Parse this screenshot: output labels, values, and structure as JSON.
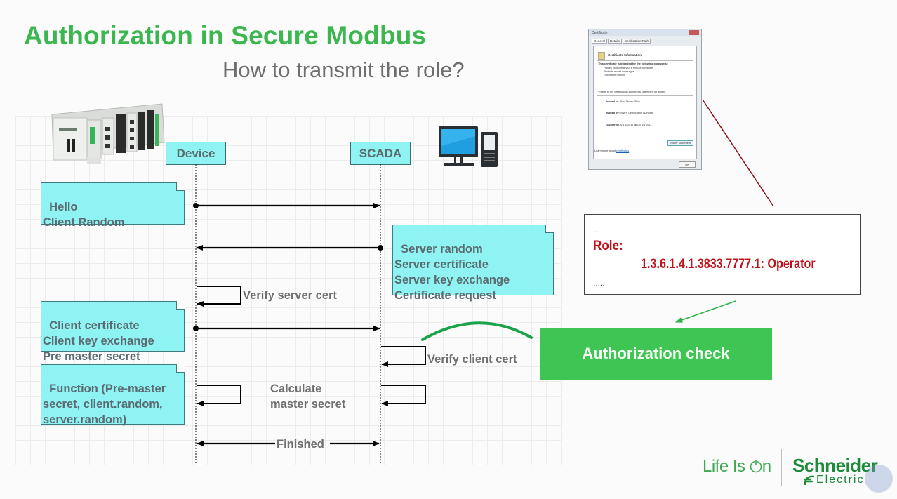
{
  "slide": {
    "title": "Authorization in Secure Modbus",
    "subtitle": "How to transmit the role?"
  },
  "sequence": {
    "participants": [
      {
        "id": "device",
        "label": "Device",
        "icon": "plc-controller-icon"
      },
      {
        "id": "scada",
        "label": "SCADA",
        "icon": "desktop-computer-icon"
      }
    ],
    "notes": [
      {
        "id": "hello",
        "text": "Hello\nClient Random"
      },
      {
        "id": "server-hello",
        "text": "Server random\nServer certificate\nServer key exchange\nCertificate request"
      },
      {
        "id": "client-cert",
        "text": "Client certificate\nClient key exchange\nPre master secret"
      },
      {
        "id": "function",
        "text": "Function (Pre-master\nsecret, client.random,\nserver.random)"
      }
    ],
    "messages": [
      {
        "from": "device",
        "to": "scada",
        "label": ""
      },
      {
        "from": "scada",
        "to": "device",
        "label": ""
      },
      {
        "from": "device",
        "to": "device",
        "label": "Verify server cert"
      },
      {
        "from": "device",
        "to": "scada",
        "label": ""
      },
      {
        "from": "scada",
        "to": "scada",
        "label": "Verify client cert"
      },
      {
        "from": "both",
        "to": "both",
        "label": "Calculate\nmaster secret"
      },
      {
        "from": "device",
        "to": "scada",
        "label": "Finished",
        "bidirectional": true
      }
    ]
  },
  "certificate_dialog": {
    "title": "Certificate",
    "tabs": [
      "General",
      "Details",
      "Certification Path"
    ],
    "heading": "Certificate Information",
    "purpose_intro": "This certificate is intended for the following purpose(s):",
    "purposes": [
      "Proves your identity to a remote computer",
      "Protects e-mail messages",
      "Document Signing"
    ],
    "footnote": "* Refer to the certification authority's statement for details.",
    "issued_to_label": "Issued to:",
    "issued_to": "Trần Thanh Phúc",
    "issued_by_label": "Issued by:",
    "issued_by": "VNPT Certification Authority",
    "valid_from_label": "Valid from",
    "valid_from": "8/ 16/ 2011",
    "valid_to_label": "to",
    "valid_to": "12/ 15/ 2011",
    "issuer_statement_button": "Issuer Statement",
    "learn_more": "Learn more about ",
    "learn_more_link": "certificates",
    "ok_button": "OK"
  },
  "role_box": {
    "ellipsis_top": "...",
    "role_label": "Role:",
    "role_value": "1.3.6.1.4.1.3833.7777.1: Operator",
    "ellipsis_bottom": "....."
  },
  "authorization_check": {
    "label": "Authorization check"
  },
  "branding": {
    "tagline_prefix": "Life Is ",
    "tagline_suffix": "n",
    "company": "Schneider",
    "company_sub": "Electric"
  },
  "colors": {
    "title_green": "#3cb64f",
    "note_cyan": "#8ff3f3",
    "role_red": "#c0101a",
    "auth_green": "#3ec553",
    "brand_green": "#1c8c3a"
  }
}
